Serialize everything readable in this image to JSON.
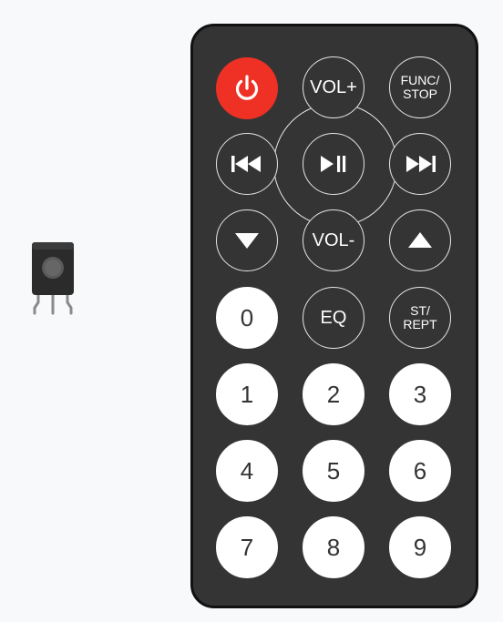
{
  "remote": {
    "colors": {
      "body": "#343434",
      "power": "#ee3124",
      "light_button": "#ffffff",
      "outline": "#e6e6e6"
    },
    "buttons": {
      "power": {
        "icon": "power-icon"
      },
      "vol_plus": {
        "label": "VOL+"
      },
      "func_stop": {
        "line1": "FUNC/",
        "line2": "STOP"
      },
      "prev": {
        "icon": "skip-back-icon"
      },
      "play_pause": {
        "icon": "play-pause-icon"
      },
      "next": {
        "icon": "skip-forward-icon"
      },
      "down": {
        "icon": "down-triangle-icon"
      },
      "vol_minus": {
        "label": "VOL-"
      },
      "up": {
        "icon": "up-triangle-icon"
      },
      "zero": {
        "label": "0"
      },
      "eq": {
        "label": "EQ"
      },
      "st_rept": {
        "line1": "ST/",
        "line2": "REPT"
      },
      "digits": [
        "1",
        "2",
        "3",
        "4",
        "5",
        "6",
        "7",
        "8",
        "9"
      ]
    }
  },
  "ir_receiver": {
    "icon": "ir-receiver-icon"
  }
}
